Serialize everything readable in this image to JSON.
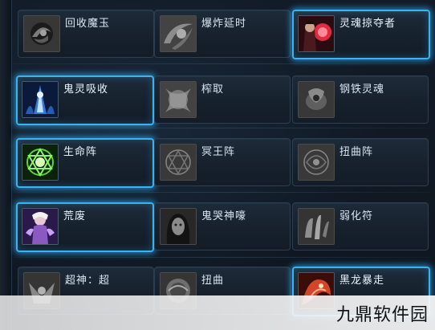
{
  "skills": [
    {
      "name": "回收魔玉",
      "icon": "swirl-orb-icon",
      "state": "locked"
    },
    {
      "name": "爆炸延时",
      "icon": "blast-swirl-icon",
      "state": "locked"
    },
    {
      "name": "灵魂掠夺者",
      "icon": "soul-reaper-icon",
      "state": "active"
    },
    {
      "name": "鬼灵吸收",
      "icon": "ghost-absorb-icon",
      "state": "active"
    },
    {
      "name": "榨取",
      "icon": "extract-icon",
      "state": "locked"
    },
    {
      "name": "钢铁灵魂",
      "icon": "steel-soul-icon",
      "state": "locked"
    },
    {
      "name": "生命阵",
      "icon": "life-array-icon",
      "state": "active"
    },
    {
      "name": "冥王阵",
      "icon": "hades-array-icon",
      "state": "locked"
    },
    {
      "name": "扭曲阵",
      "icon": "twist-array-icon",
      "state": "locked"
    },
    {
      "name": "荒废",
      "icon": "desolation-icon",
      "state": "active"
    },
    {
      "name": "鬼哭神嚎",
      "icon": "ghost-wail-icon",
      "state": "locked"
    },
    {
      "name": "弱化符",
      "icon": "weaken-charm-icon",
      "state": "locked"
    },
    {
      "name": "超神：超",
      "icon": "super-god-icon",
      "state": "locked"
    },
    {
      "name": "扭曲",
      "icon": "twist-icon",
      "state": "locked"
    },
    {
      "name": "黑龙暴走",
      "icon": "black-dragon-icon",
      "state": "active"
    }
  ],
  "watermark": "九鼎软件园",
  "colors": {
    "highlight": "#3fb2ee",
    "panel": "#1d2a38",
    "text": "#d9e6f2"
  }
}
